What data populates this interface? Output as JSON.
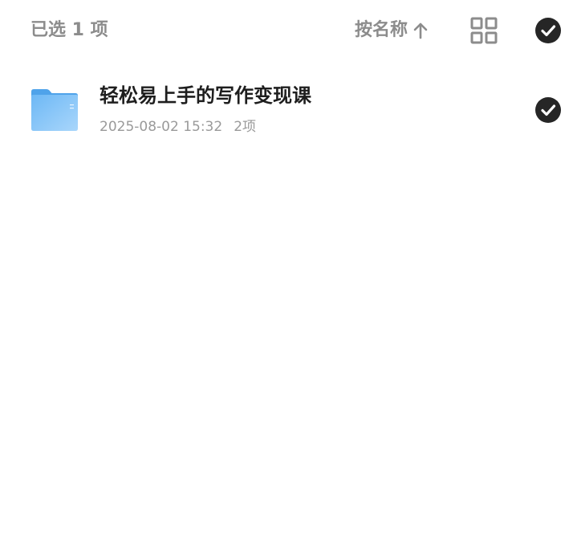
{
  "header": {
    "selected_label": "已选 1 项",
    "sort_label": "按名称",
    "sort_direction_icon": "arrow-up-icon",
    "view_toggle_icon": "grid-view-icon",
    "select_all_icon": "check-circle-icon"
  },
  "items": [
    {
      "name": "轻松易上手的写作变现课",
      "date": "2025-08-02 15:32",
      "count": "2项",
      "icon": "folder-icon",
      "selected": true
    }
  ],
  "colors": {
    "muted_text": "#8c8c8c",
    "title_text": "#1e1e1e",
    "check_fill": "#262626",
    "folder_blue": "#5aaef0"
  }
}
